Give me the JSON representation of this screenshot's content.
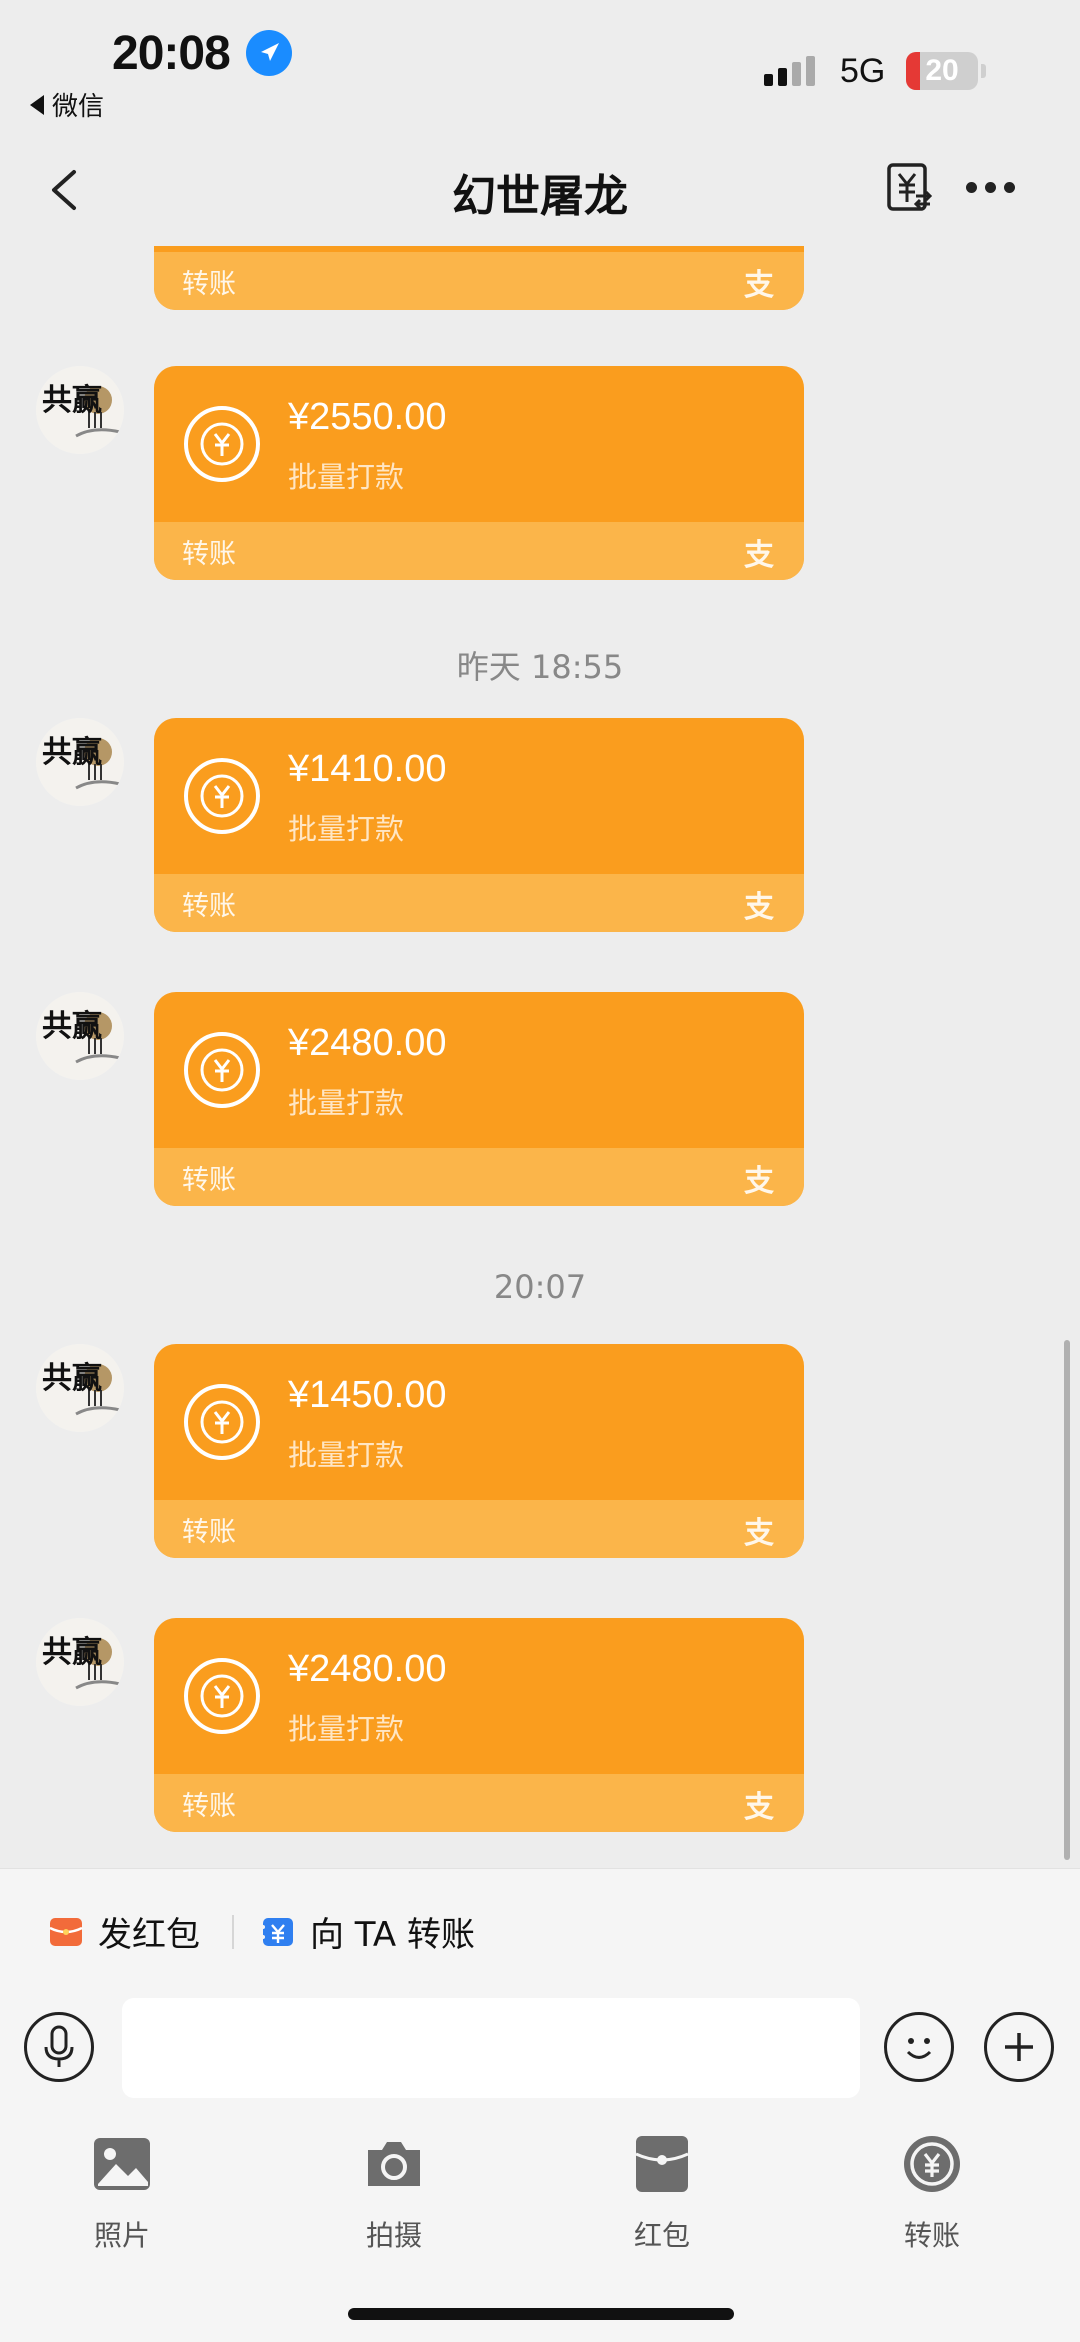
{
  "status_bar": {
    "time": "20:08",
    "back_app": "微信",
    "network": "5G",
    "battery_level": "20",
    "battery_fraction": 0.2
  },
  "nav": {
    "title": "幻世屠龙"
  },
  "chat": {
    "top_partial": {
      "foot_label": "转账",
      "foot_logo": "支"
    },
    "messages": [
      {
        "amount": "¥2550.00",
        "note": "批量打款",
        "foot_label": "转账",
        "foot_logo": "支"
      },
      {
        "amount": "¥1410.00",
        "note": "批量打款",
        "foot_label": "转账",
        "foot_logo": "支"
      },
      {
        "amount": "¥2480.00",
        "note": "批量打款",
        "foot_label": "转账",
        "foot_logo": "支"
      },
      {
        "amount": "¥1450.00",
        "note": "批量打款",
        "foot_label": "转账",
        "foot_logo": "支"
      },
      {
        "amount": "¥2480.00",
        "note": "批量打款",
        "foot_label": "转账",
        "foot_logo": "支"
      }
    ],
    "timestamps": [
      "昨天 18:55",
      "20:07"
    ],
    "avatar_text": "共赢"
  },
  "quick_actions": {
    "red_packet": "发红包",
    "transfer": "向 TA 转账"
  },
  "input": {
    "value": "",
    "placeholder": ""
  },
  "panel": [
    {
      "label": "照片",
      "icon": "photo-icon"
    },
    {
      "label": "拍摄",
      "icon": "camera-icon"
    },
    {
      "label": "红包",
      "icon": "red-packet-icon"
    },
    {
      "label": "转账",
      "icon": "transfer-icon"
    }
  ],
  "colors": {
    "bubble": "#fa9d1e",
    "bubble_footer": "#fbb54a",
    "background": "#ededed",
    "location_icon": "#1a8cff",
    "battery_low": "#e53935"
  }
}
